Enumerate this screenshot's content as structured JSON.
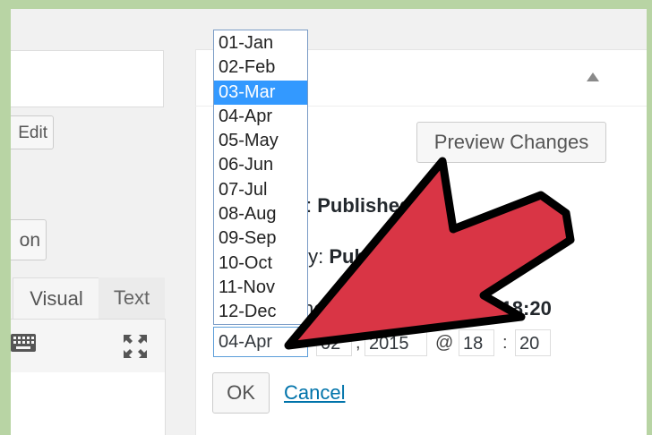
{
  "left_column": {
    "edit_label": "Edit",
    "media_label": "on",
    "tab_visual": "Visual",
    "tab_text": "Text",
    "icons": [
      "keyboard-icon",
      "fullscreen-icon"
    ]
  },
  "publish": {
    "preview_label": "Preview Changes",
    "status_prefix": ":",
    "status_value": "Published",
    "visibility_prefix": "ty:",
    "visibility_value": "Pub",
    "published_prefix": "he",
    "time_bold": "@ 18:20",
    "collapse_icon": "triangle-up-icon"
  },
  "date_edit": {
    "month_selected": "04-Apr",
    "day": "02",
    "year": "2015",
    "hour": "18",
    "minute": "20",
    "comma": ",",
    "at": "@",
    "colon": ":",
    "months": [
      "01-Jan",
      "02-Feb",
      "03-Mar",
      "04-Apr",
      "05-May",
      "06-Jun",
      "07-Jul",
      "08-Aug",
      "09-Sep",
      "10-Oct",
      "11-Nov",
      "12-Dec"
    ],
    "highlighted_index": 2
  },
  "actions": {
    "ok_label": "OK",
    "cancel_label": "Cancel"
  },
  "colors": {
    "highlight": "#3399ff",
    "link": "#0073aa",
    "arrow_fill": "#d93545",
    "background_border": "#b8d4a4"
  }
}
